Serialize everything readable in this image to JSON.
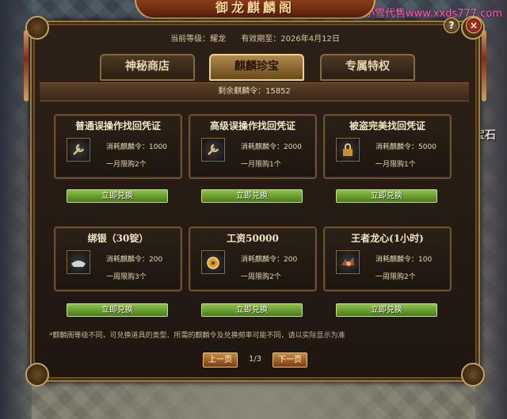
{
  "watermark": "小雪代售www.xxds777.com",
  "banner_title": "御龙麒麟阁",
  "world_text": "宝石",
  "window": {
    "help_icon": "?",
    "close_icon": "×",
    "current_level_label": "当前等级：耀龙",
    "valid_until_label": "有效期至：2026年4月12日",
    "tabs": [
      {
        "label": "神秘商店",
        "active": false
      },
      {
        "label": "麒麟珍宝",
        "active": true
      },
      {
        "label": "专属特权",
        "active": false
      }
    ],
    "remaining": "剩余麒麟令：15852",
    "items": [
      {
        "title": "普通误操作找回凭证",
        "cost": "消耗麒麟令：1000",
        "limit": "一月限购2个",
        "icon": "wrench-icon",
        "redeem": "立即兑换"
      },
      {
        "title": "高级误操作找回凭证",
        "cost": "消耗麒麟令：2000",
        "limit": "一月限购1个",
        "icon": "wrench-icon",
        "redeem": "立即兑换"
      },
      {
        "title": "被盗完美找回凭证",
        "cost": "消耗麒麟令：5000",
        "limit": "一月限购1个",
        "icon": "lock-icon",
        "redeem": "立即兑换"
      },
      {
        "title": "绑银（30锭）",
        "cost": "消耗麒麟令：200",
        "limit": "一周限购3个",
        "icon": "silver-ingot-icon",
        "redeem": "立即兑换"
      },
      {
        "title": "工资50000",
        "cost": "消耗麒麟令：200",
        "limit": "一周限购2个",
        "icon": "gold-coin-icon",
        "redeem": "立即兑换"
      },
      {
        "title": "王者龙心(1小时)",
        "cost": "消耗麒麟令：100",
        "limit": "一周限购2个",
        "icon": "dragon-heart-icon",
        "redeem": "立即兑换"
      }
    ],
    "note": "*麒麟阁等级不同，可兑换道具的类型、所需的麒麟令及兑换频率可能不同，请以实际显示为准",
    "pager": {
      "prev": "上一页",
      "page": "1/3",
      "next": "下一页"
    }
  }
}
